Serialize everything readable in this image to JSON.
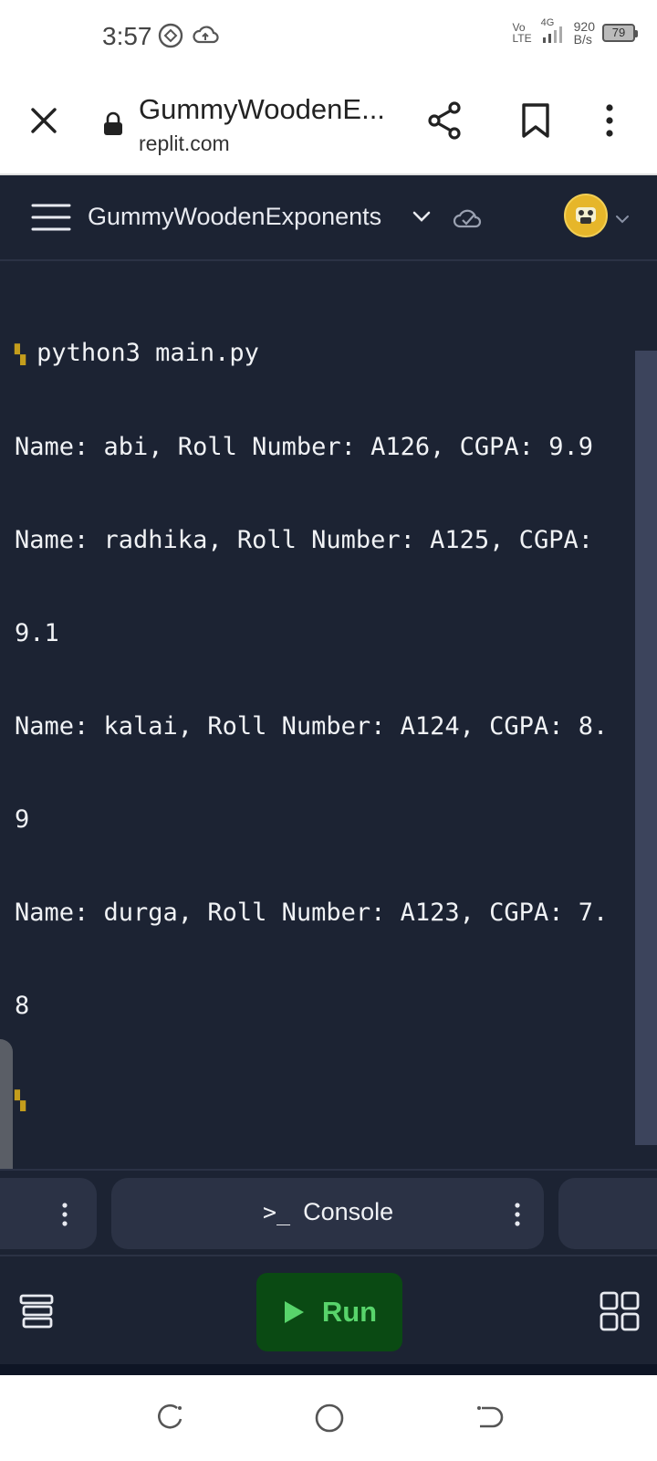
{
  "status_bar": {
    "time": "3:57",
    "network_label_top": "Vo",
    "network_label_bottom": "LTE",
    "network_gen": "4G",
    "speed_value": "920",
    "speed_unit": "B/s",
    "battery": "79"
  },
  "browser": {
    "title": "GummyWoodenE...",
    "url": "replit.com"
  },
  "app_header": {
    "repl_name": "GummyWoodenExponents"
  },
  "console": {
    "lines": [
      "python3 main.py",
      "Name: abi, Roll Number: A126, CGPA: 9.9",
      "Name: radhika, Roll Number: A125, CGPA:",
      "9.1",
      "Name: kalai, Roll Number: A124, CGPA: 8.",
      "9",
      "Name: durga, Roll Number: A123, CGPA: 7.",
      "8"
    ]
  },
  "tabs": {
    "console_glyph": ">_",
    "console_label": "Console"
  },
  "toolbar": {
    "run_label": "Run"
  },
  "colors": {
    "background": "#1c2333",
    "panel": "#2b3245",
    "run_bg": "#0a4a13",
    "run_text": "#58d46b",
    "prompt": "#c49d1c"
  }
}
